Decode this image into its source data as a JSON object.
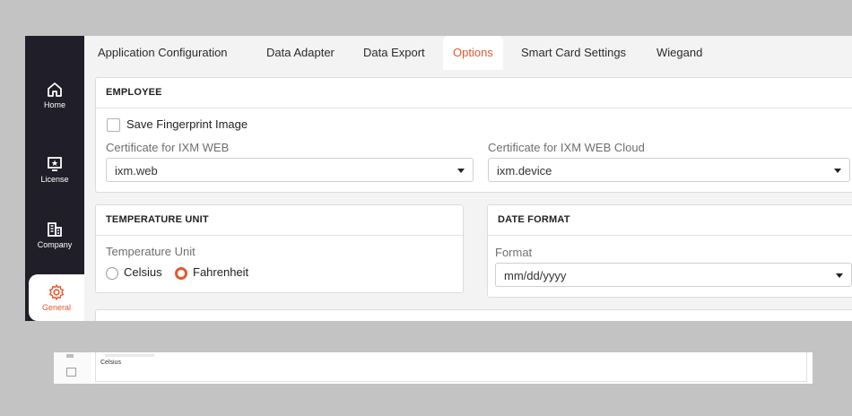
{
  "sidebar": {
    "items": [
      {
        "label": "Home",
        "icon": "home-icon"
      },
      {
        "label": "License",
        "icon": "license-icon"
      },
      {
        "label": "Company",
        "icon": "company-icon"
      },
      {
        "label": "General",
        "icon": "gear-icon"
      }
    ],
    "active": "General"
  },
  "tabs": [
    {
      "label": "Application Configuration"
    },
    {
      "label": "Data Adapter"
    },
    {
      "label": "Data Export"
    },
    {
      "label": "Options"
    },
    {
      "label": "Smart Card Settings"
    },
    {
      "label": "Wiegand"
    }
  ],
  "active_tab": "Options",
  "employee": {
    "title": "EMPLOYEE",
    "save_fingerprint_label": "Save Fingerprint Image",
    "cert_web_label": "Certificate for IXM WEB",
    "cert_web_value": "ixm.web",
    "cert_cloud_label": "Certificate for IXM WEB Cloud",
    "cert_cloud_value": "ixm.device"
  },
  "temperature": {
    "title": "TEMPERATURE UNIT",
    "field_label": "Temperature Unit",
    "options": [
      "Celsius",
      "Fahrenheit"
    ],
    "selected": "Fahrenheit"
  },
  "date_format": {
    "title": "DATE FORMAT",
    "field_label": "Format",
    "value": "mm/dd/yyyy"
  },
  "thumbnail": {
    "value_text": "Celsius"
  },
  "colors": {
    "accent": "#e8572b",
    "sidebar_bg": "#1f1e29",
    "backdrop": "#c3c3c3"
  }
}
